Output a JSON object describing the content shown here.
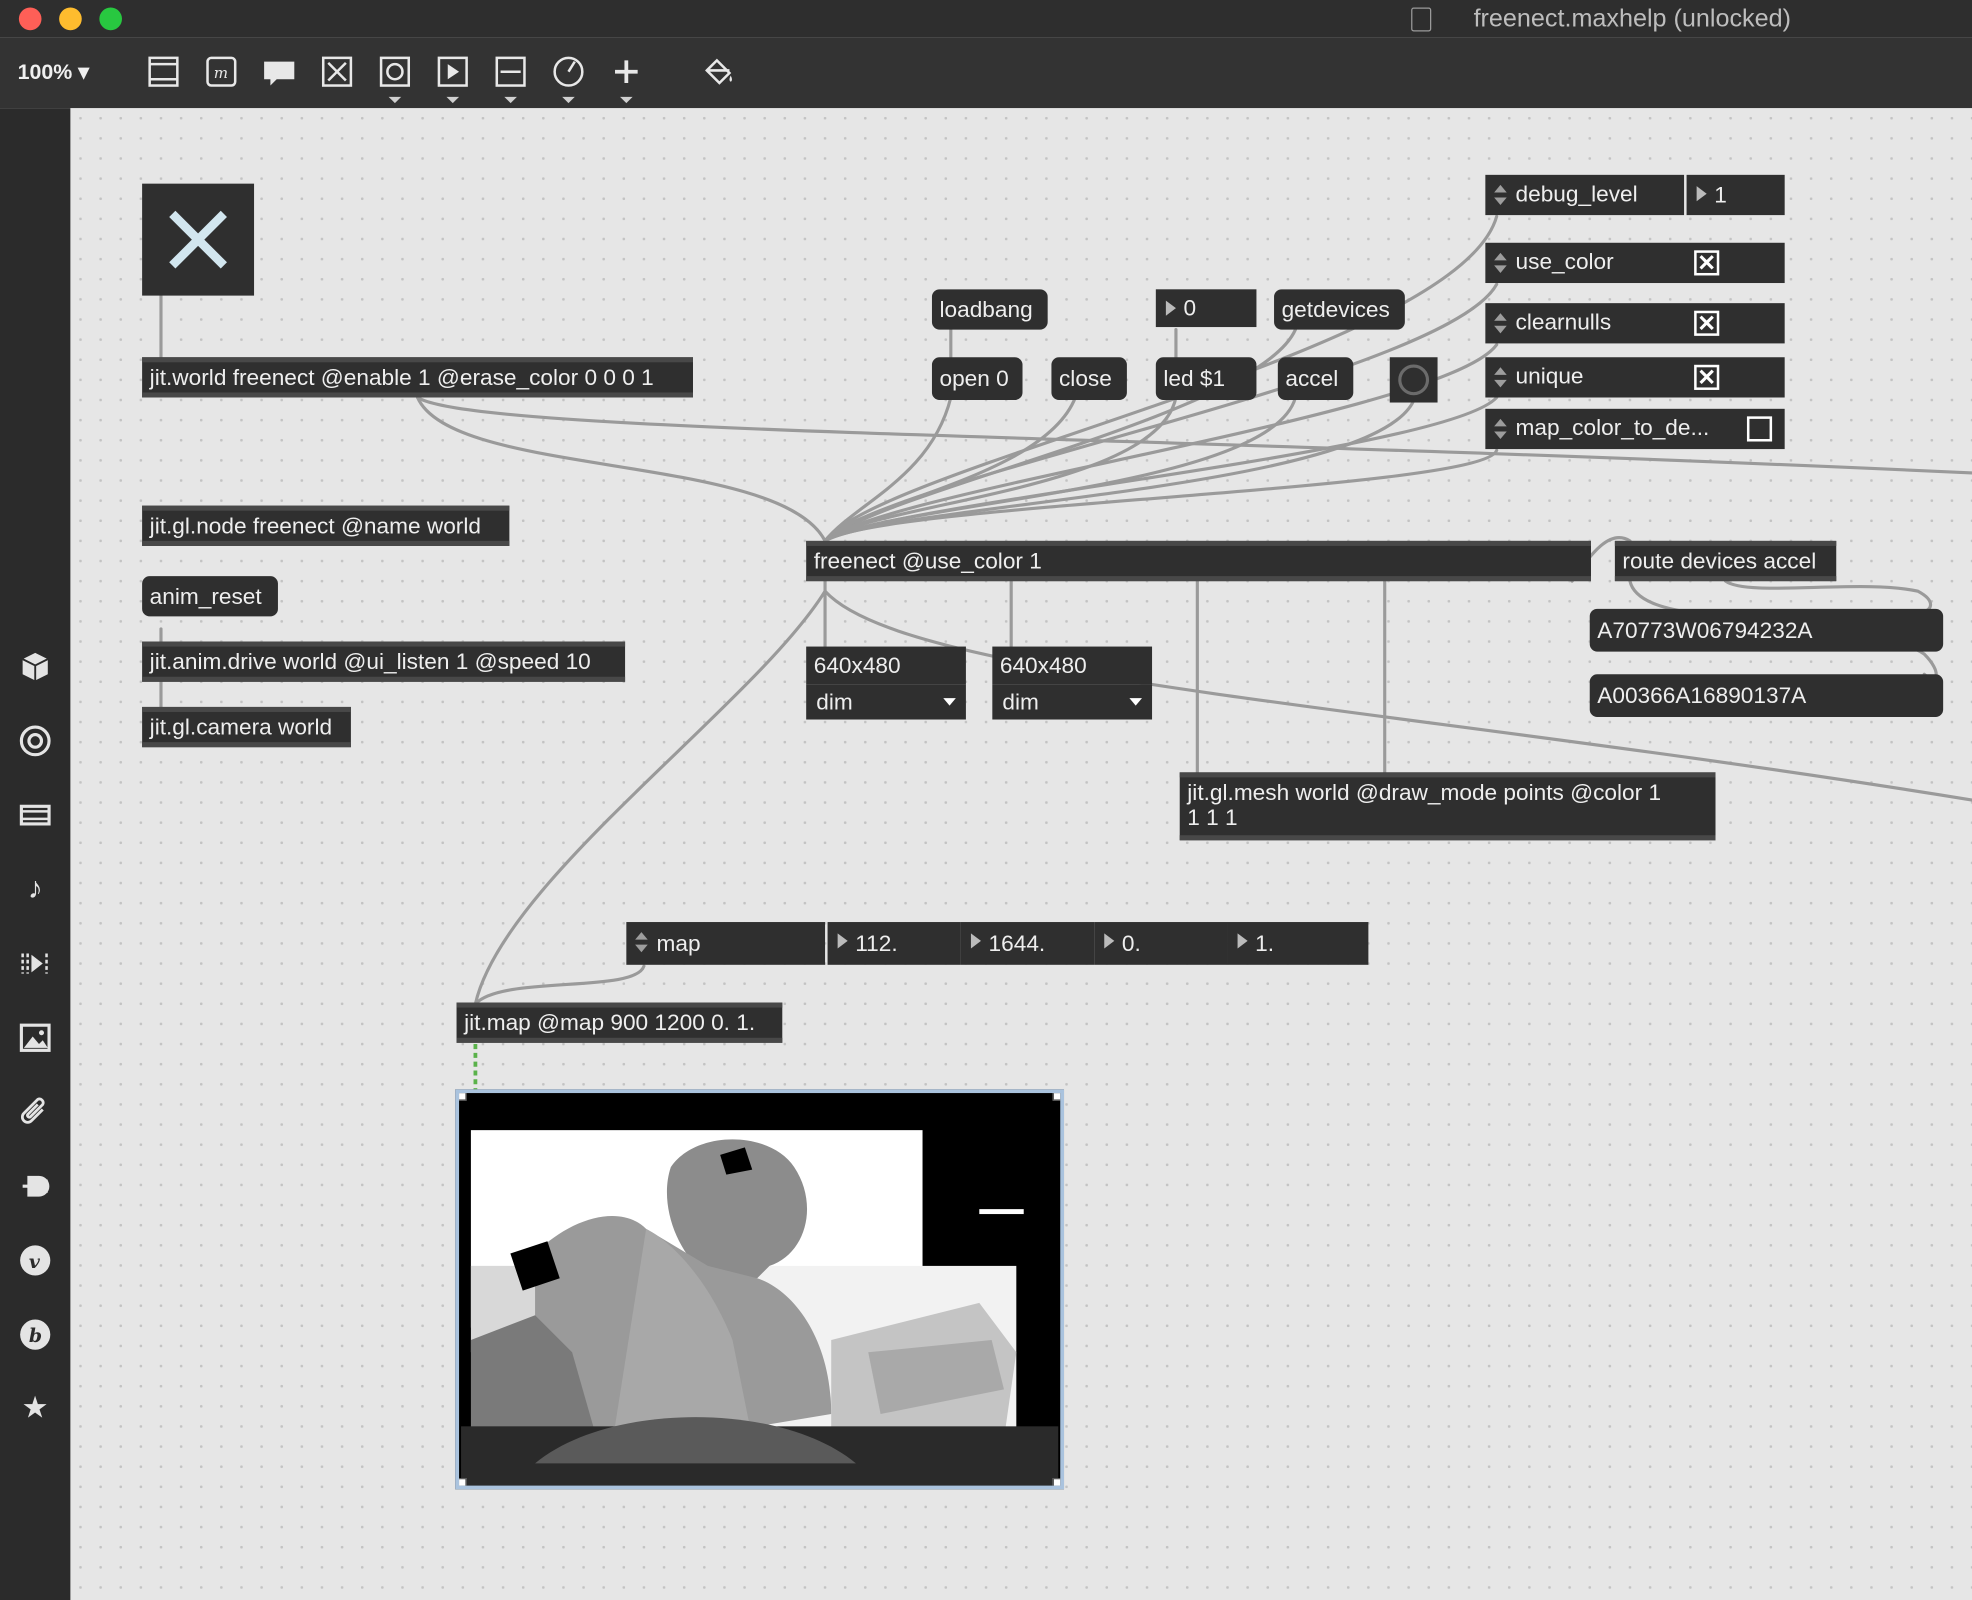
{
  "window": {
    "title": "freenect.maxhelp (unlocked)",
    "traffic_light_colors": [
      "#fe5f57",
      "#febc2e",
      "#28c840"
    ]
  },
  "toolbar": {
    "zoom": "100% ▾",
    "tools": [
      "object-box-icon",
      "message-box-icon",
      "comment-icon",
      "toggle-icon",
      "button-icon",
      "playbar-icon",
      "slider-icon",
      "dial-icon",
      "add-object-icon",
      "paint-bucket-icon"
    ]
  },
  "sidebar": {
    "icons": [
      "cube-icon",
      "target-icon",
      "film-icon",
      "music-note-icon",
      "media-step-icon",
      "image-icon",
      "paperclip-icon",
      "plug-icon",
      "vimeo-icon",
      "bandcamp-icon",
      "star-icon"
    ]
  },
  "patch": {
    "objects": {
      "jit_world": "jit.world freenect @enable 1 @erase_color 0 0 0 1",
      "jit_gl_node": "jit.gl.node freenect @name world",
      "jit_anim_drive": "jit.anim.drive world @ui_listen 1 @speed 10",
      "jit_gl_camera": "jit.gl.camera world",
      "freenect": "freenect @use_color 1",
      "route": "route devices accel",
      "jit_gl_mesh_line1": "jit.gl.mesh world @draw_mode points @color 1",
      "jit_gl_mesh_line2": "1 1 1",
      "jit_map": "jit.map @map 900 1200 0. 1."
    },
    "messages": {
      "anim_reset": "anim_reset",
      "loadbang": "loadbang",
      "open": "open 0",
      "close": "close",
      "led": "led $1",
      "accel": "accel",
      "getdevices": "getdevices",
      "device1": "A70773W06794232A",
      "device2": "A00366A16890137A"
    },
    "number_boxes": {
      "led_value": "0",
      "debug_value": "1",
      "map1": "112.",
      "map2": "1644.",
      "map3": "0.",
      "map4": "1."
    },
    "attrui": {
      "debug_level": "debug_level",
      "use_color": "use_color",
      "clearnulls": "clearnulls",
      "unique": "unique",
      "map_color_to_depth": "map_color_to_de...",
      "map": "map"
    },
    "checkboxes": {
      "use_color": true,
      "clearnulls": true,
      "unique": true,
      "map_color_to_depth": false
    },
    "dim_readouts": [
      {
        "dims": "640x480",
        "menu": "dim"
      },
      {
        "dims": "640x480",
        "menu": "dim"
      }
    ],
    "toggle_state": true
  }
}
